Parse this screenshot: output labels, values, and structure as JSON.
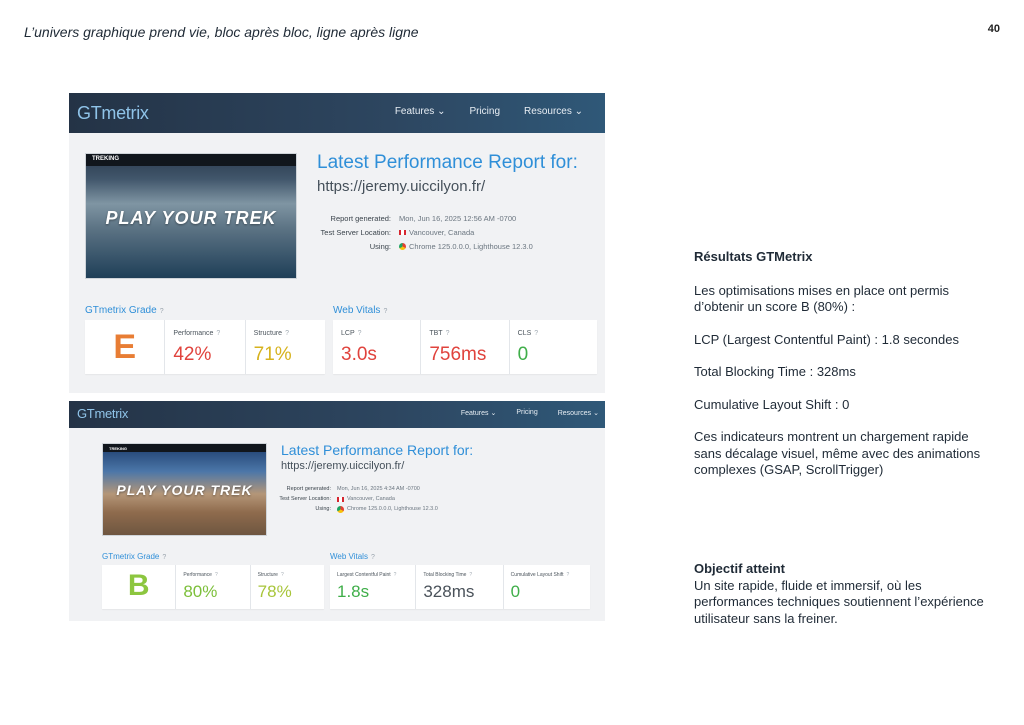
{
  "page": {
    "title": "L’univers graphique prend vie, bloc après bloc, ligne après ligne",
    "number": "40"
  },
  "shots": [
    {
      "nav": {
        "logo_gt": "GT",
        "logo_rest": "metrix",
        "features": "Features ⌄",
        "pricing": "Pricing",
        "resources": "Resources ⌄"
      },
      "thumbnail": {
        "brand": "TREKING",
        "hero": "PLAY YOUR TREK"
      },
      "report": {
        "title": "Latest Performance Report for:",
        "url": "https://jeremy.uiccilyon.fr/",
        "generated_label": "Report generated:",
        "generated_value": "Mon, Jun 16, 2025 12:56 AM -0700",
        "location_label": "Test Server Location:",
        "location_value": "Vancouver, Canada",
        "using_label": "Using:",
        "using_value": "Chrome 125.0.0.0, Lighthouse 12.3.0"
      },
      "grade_section": "GTmetrix Grade",
      "vitals_section": "Web Vitals",
      "grade": "E",
      "metrics": [
        {
          "label": "Performance",
          "value": "42%"
        },
        {
          "label": "Structure",
          "value": "71%"
        }
      ],
      "vitals": [
        {
          "label": "LCP",
          "value": "3.0s"
        },
        {
          "label": "TBT",
          "value": "756ms"
        },
        {
          "label": "CLS",
          "value": "0"
        }
      ],
      "colors": {
        "grade": "#e87d34",
        "perf": "#e0433d",
        "struct": "#d6b21d",
        "lcp": "#e0433d",
        "tbt": "#e0433d",
        "cls": "#3fae49"
      }
    },
    {
      "nav": {
        "logo_gt": "GT",
        "logo_rest": "metrix",
        "features": "Features ⌄",
        "pricing": "Pricing",
        "resources": "Resources ⌄"
      },
      "thumbnail": {
        "brand": "TREKING",
        "hero": "PLAY YOUR TREK"
      },
      "report": {
        "title": "Latest Performance Report for:",
        "url": "https://jeremy.uiccilyon.fr/",
        "generated_label": "Report generated:",
        "generated_value": "Mon, Jun 16, 2025 4:34 AM -0700",
        "location_label": "Test Server Location:",
        "location_value": "Vancouver, Canada",
        "using_label": "Using:",
        "using_value": "Chrome 125.0.0.0, Lighthouse 12.3.0"
      },
      "grade_section": "GTmetrix Grade",
      "vitals_section": "Web Vitals",
      "grade": "B",
      "metrics": [
        {
          "label": "Performance",
          "value": "80%"
        },
        {
          "label": "Structure",
          "value": "78%"
        }
      ],
      "vitals": [
        {
          "label": "Largest Contentful Paint",
          "value": "1.8s"
        },
        {
          "label": "Total Blocking Time",
          "value": "328ms"
        },
        {
          "label": "Cumulative Layout Shift",
          "value": "0"
        }
      ],
      "colors": {
        "grade": "#8cc63f",
        "perf": "#7cbf3a",
        "struct": "#a8c53a",
        "lcp": "#3fae49",
        "tbt": "#4a525a",
        "cls": "#3fae49"
      }
    }
  ],
  "results": {
    "heading": "Résultats GTMetrix",
    "intro": "Les optimisations mises en place ont permis d’obtenir un score B (80%) :",
    "lcp": "LCP (Largest Contentful Paint) : 1.8 secondes",
    "tbt": "Total Blocking Time : 328ms",
    "cls": "Cumulative Layout Shift : 0",
    "summary": "Ces indicateurs montrent un chargement rapide sans décalage visuel, même avec des animations complexes (GSAP, ScrollTrigger)"
  },
  "objective": {
    "heading": "Objectif atteint",
    "text": "Un site rapide, fluide et immersif, où les performances techniques soutiennent l’expérience utilisateur sans la freiner."
  }
}
